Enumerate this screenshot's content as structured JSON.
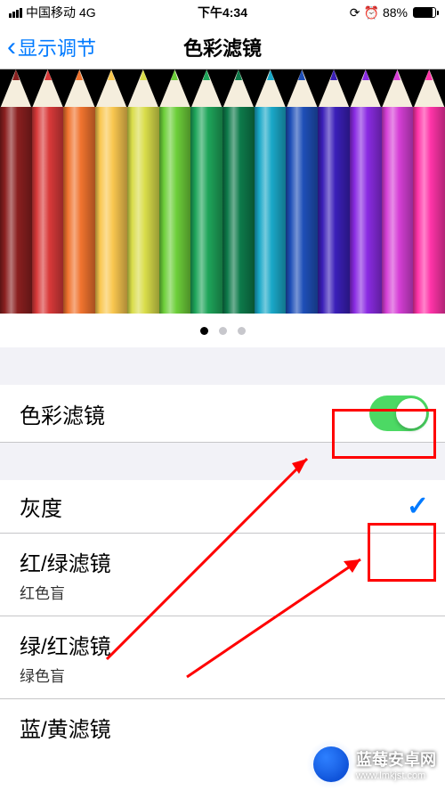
{
  "status": {
    "carrier": "中国移动",
    "network": "4G",
    "time": "下午4:34",
    "battery_pct": "88%",
    "orientation_locked": true,
    "alarm": true
  },
  "nav": {
    "back_label": "显示调节",
    "title": "色彩滤镜"
  },
  "hero": {
    "pencil_colors": [
      "#8a1f1f",
      "#d93a3a",
      "#f0732e",
      "#f9c74f",
      "#d9dd4a",
      "#6dcf3a",
      "#1ea55a",
      "#0d7a4a",
      "#1aa8c8",
      "#1e4fb8",
      "#3a1fb8",
      "#8a2be2",
      "#d63fd6",
      "#ff33a8"
    ],
    "page_index": 0,
    "page_count": 3
  },
  "list": {
    "toggle": {
      "label": "色彩滤镜",
      "value": true
    },
    "options": [
      {
        "label": "灰度",
        "sub": "",
        "selected": true
      },
      {
        "label": "红/绿滤镜",
        "sub": "红色盲",
        "selected": false
      },
      {
        "label": "绿/红滤镜",
        "sub": "绿色盲",
        "selected": false
      },
      {
        "label": "蓝/黄滤镜",
        "sub": "",
        "selected": false
      }
    ]
  },
  "annotations": {
    "highlight_color": "#ff0000"
  },
  "watermark": {
    "title": "蓝莓安卓网",
    "url": "www.lmkjst.com"
  }
}
